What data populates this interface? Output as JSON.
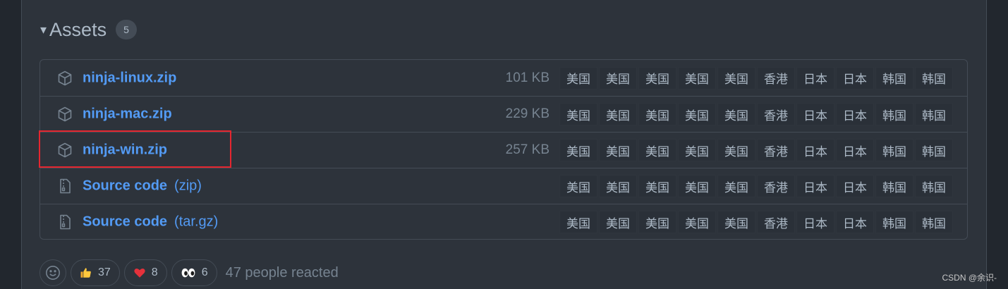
{
  "header": {
    "title": "Assets",
    "count": "5",
    "toggle_glyph": "▾"
  },
  "assets": [
    {
      "name": "ninja-linux.zip",
      "ext": "",
      "size": "101 KB",
      "icon": "package-icon"
    },
    {
      "name": "ninja-mac.zip",
      "ext": "",
      "size": "229 KB",
      "icon": "package-icon"
    },
    {
      "name": "ninja-win.zip",
      "ext": "",
      "size": "257 KB",
      "icon": "package-icon"
    },
    {
      "name": "Source code",
      "ext": "(zip)",
      "size": "",
      "icon": "file-zip-icon"
    },
    {
      "name": "Source code",
      "ext": "(tar.gz)",
      "size": "",
      "icon": "file-zip-icon"
    }
  ],
  "mirrors": [
    "美国",
    "美国",
    "美国",
    "美国",
    "美国",
    "香港",
    "日本",
    "日本",
    "韩国",
    "韩国"
  ],
  "reactions": {
    "thumbs_up": "37",
    "heart": "8",
    "eyes": "6",
    "summary": "47 people reacted"
  },
  "highlight_color": "#e5262f",
  "link_color": "#539bf5",
  "watermark": "CSDN @余识-"
}
